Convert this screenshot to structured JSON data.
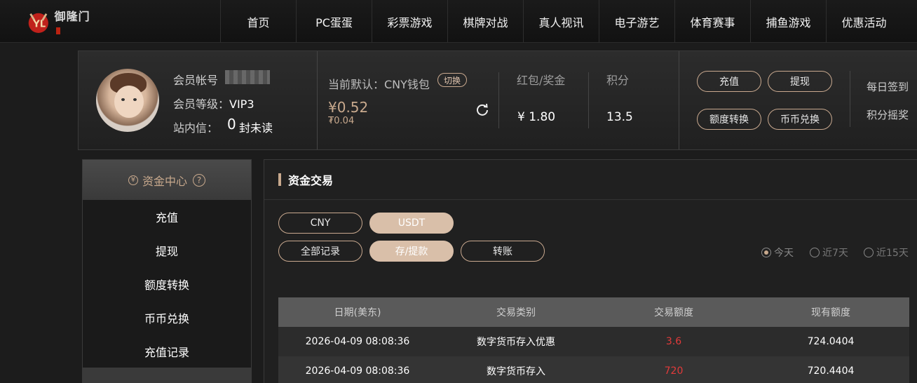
{
  "brand": {
    "name": "御隆门"
  },
  "nav": {
    "items": [
      "首页",
      "PC蛋蛋",
      "彩票游戏",
      "棋牌对战",
      "真人视讯",
      "电子游艺",
      "体育赛事",
      "捕鱼游戏",
      "优惠活动"
    ]
  },
  "member": {
    "account_label": "会员帐号",
    "level_label": "会员等级：",
    "level_value": "VIP3",
    "inbox_label": "站内信：",
    "inbox_count": "0",
    "inbox_suffix": "封未读",
    "wallet_label": "当前默认：CNY钱包",
    "switch_label": "切换",
    "balance_main": "¥0.52",
    "balance_sub": "₮0.04",
    "redpacket_label": "红包/奖金",
    "redpacket_value": "¥ 1.80",
    "points_label": "积分",
    "points_value": "13.5",
    "buttons": {
      "deposit": "充值",
      "withdraw": "提现",
      "transfer": "额度转换",
      "exchange": "币币兑换"
    },
    "links": {
      "signin": "每日签到",
      "lottery": "积分摇奖"
    }
  },
  "sidebar": {
    "title": "资金中心",
    "help": "?",
    "yen": "¥",
    "items": [
      "充值",
      "提现",
      "额度转换",
      "币币兑换",
      "充值记录"
    ]
  },
  "main": {
    "title": "资金交易",
    "currency_tabs": [
      "CNY",
      "USDT"
    ],
    "active_currency": "USDT",
    "type_tabs": [
      "全部记录",
      "存/提款",
      "转账"
    ],
    "active_type": "存/提款",
    "ranges": [
      "今天",
      "近7天",
      "近15天"
    ],
    "active_range": "今天",
    "table": {
      "headers": [
        "日期(美东)",
        "交易类别",
        "交易额度",
        "现有额度"
      ],
      "rows": [
        [
          "2026-04-09 08:08:36",
          "数字货币存入优惠",
          "3.6",
          "724.0404"
        ],
        [
          "2026-04-09 08:08:36",
          "数字货币存入",
          "720",
          "720.4404"
        ]
      ]
    },
    "amount_color": "#e23a3a",
    "accent_color": "#c8a98d"
  }
}
